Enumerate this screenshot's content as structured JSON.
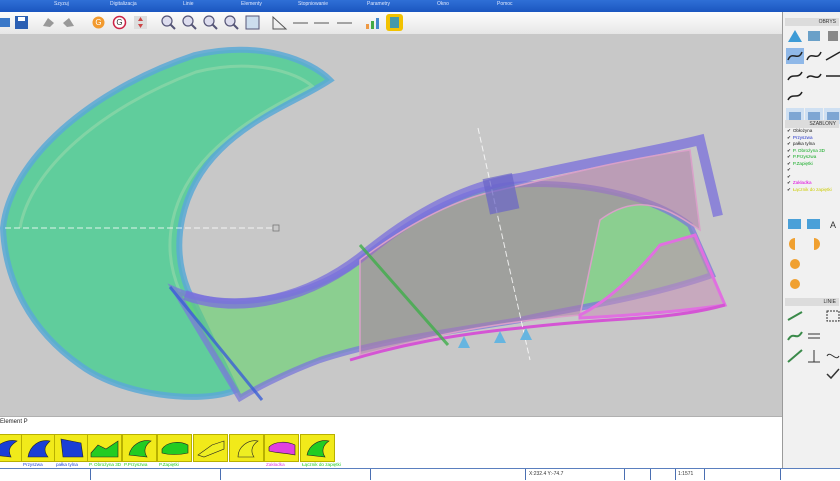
{
  "menu": [
    {
      "label": "Szyzuj"
    },
    {
      "label": "Digitalizacja"
    },
    {
      "label": "Linie"
    },
    {
      "label": "Elementy"
    },
    {
      "label": "Stopniowanie"
    },
    {
      "label": "Parametry"
    },
    {
      "label": "Okno"
    },
    {
      "label": "Pomoc"
    }
  ],
  "right_panel": {
    "header1": "OBRYS",
    "header2": "SZABLONY",
    "header3": "LINIE",
    "layers": [
      {
        "label": "Obłożyna",
        "color": "#222222"
      },
      {
        "label": "Przyszwa",
        "color": "#2233cc"
      },
      {
        "label": "pałka tylna",
        "color": "#222222"
      },
      {
        "label": "P. Obrożyna 3D",
        "color": "#11aa22"
      },
      {
        "label": "P.Przyszwa",
        "color": "#11aa22"
      },
      {
        "label": "P.Zapiętki",
        "color": "#11aa22"
      },
      {
        "label": "",
        "color": "#d9d900"
      },
      {
        "label": "",
        "color": "#d9d900"
      },
      {
        "label": "Zakładka",
        "color": "#dd00dd"
      },
      {
        "label": "Łącznik do zapiętki",
        "color": "#dddd00"
      }
    ]
  },
  "bottom": {
    "tab_label": "Element P",
    "thumbnails": [
      {
        "label": "",
        "color": "#1a3fd6"
      },
      {
        "label": "Przyszwa",
        "color": "#1a3fd6"
      },
      {
        "label": "pałka tylna",
        "color": "#1a3fd6"
      },
      {
        "label": "P. Obrożyna 3D",
        "color": "#22cc22"
      },
      {
        "label": "P.Przyszwa",
        "color": "#22cc22"
      },
      {
        "label": "P.Zapiętki",
        "color": "#22cc22"
      },
      {
        "label": "",
        "color": "#eeee22"
      },
      {
        "label": "",
        "color": "#eeee22"
      },
      {
        "label": "Zakładka",
        "color": "#e040e0"
      },
      {
        "label": "Łącznik do zapiętki",
        "color": "#22cc22"
      }
    ]
  },
  "status": {
    "coords": "X:232.4 Y:-74.7",
    "scale": "1:1571"
  }
}
